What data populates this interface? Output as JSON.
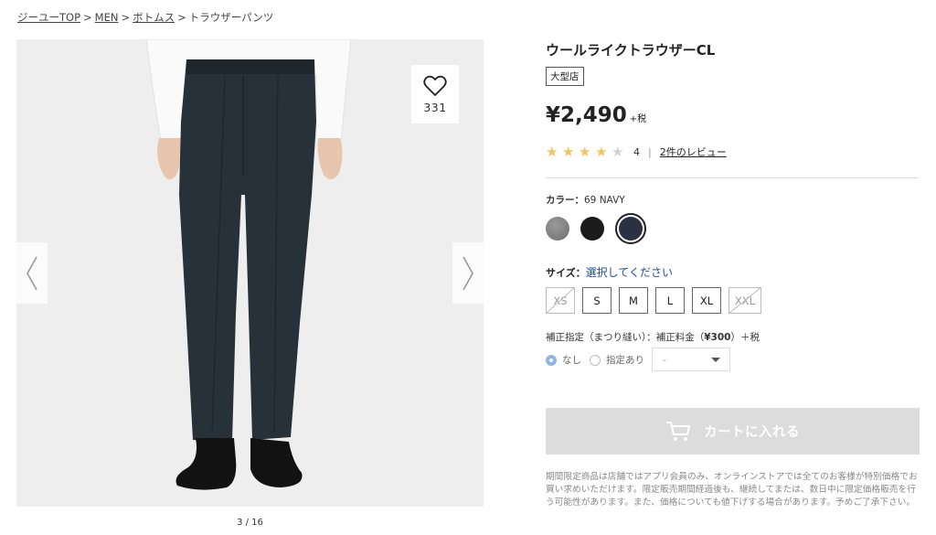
{
  "breadcrumb": {
    "items": [
      "ジーユーTOP",
      "MEN",
      "ボトムス"
    ],
    "current": "トラウザーパンツ",
    "separator": ">"
  },
  "gallery": {
    "favorite_count": "331",
    "pager": "3 / 16"
  },
  "product": {
    "title": "ウールライクトラウザーCL",
    "tag": "大型店",
    "price": "¥2,490",
    "tax_note": "+税",
    "rating_value": 4,
    "rating_max": 5,
    "rating_text": "4",
    "rating_sep": "|",
    "review_link": "2件のレビュー"
  },
  "color": {
    "label": "カラー：",
    "selected": "69 NAVY",
    "swatches": [
      {
        "name": "gray",
        "hex": "#7d7d7d"
      },
      {
        "name": "black",
        "hex": "#1c1c1c"
      },
      {
        "name": "navy",
        "hex": "#2a3140",
        "selected": true
      }
    ]
  },
  "size": {
    "label": "サイズ：",
    "prompt": "選択してください",
    "options": [
      {
        "label": "XS",
        "available": false
      },
      {
        "label": "S",
        "available": true
      },
      {
        "label": "M",
        "available": true
      },
      {
        "label": "L",
        "available": true
      },
      {
        "label": "XL",
        "available": true
      },
      {
        "label": "XXL",
        "available": false
      }
    ]
  },
  "hem": {
    "label": "補正指定（まつり縫い）：補正料金（",
    "fee": "¥300",
    "suffix": "）＋税",
    "option_none": "なし",
    "option_specified": "指定あり",
    "select_value": "-"
  },
  "cart": {
    "label": "カートに入れる"
  },
  "notice": "期間限定商品は店舗ではアプリ会員のみ、オンラインストアでは全てのお客様が特別価格でお買い求めいただけます。限定販売期間経過後も、継続してまたは、数日中に限定価格販売を行う可能性があります。また、価格についても値下げする場合があります。予めご了承下さい。",
  "colors": {
    "cart_disabled": "#dcdcdc",
    "star_on": "#f3c45d",
    "link_blue": "#1f4da0"
  }
}
